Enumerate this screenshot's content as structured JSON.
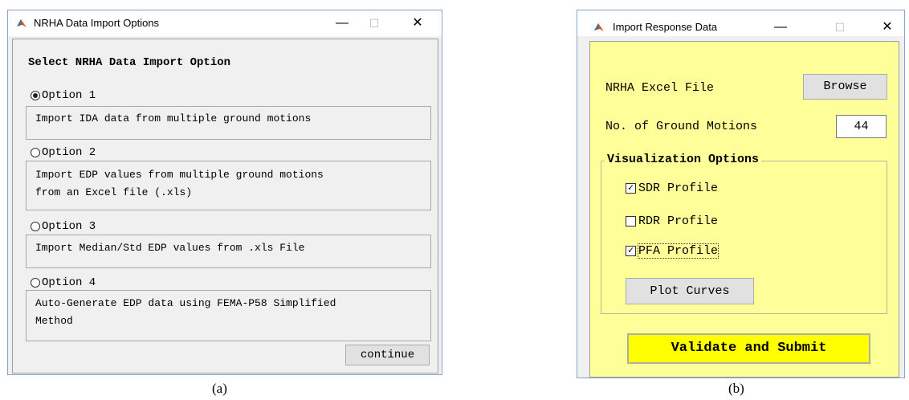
{
  "window_a": {
    "title": "NRHA Data Import Options",
    "minimize_glyph": "—",
    "maximize_glyph": "☐",
    "close_glyph": "✕",
    "header": "Select NRHA Data Import Option",
    "options": [
      {
        "label": "Option 1",
        "selected": true,
        "lines": [
          "Import IDA data from multiple ground motions"
        ]
      },
      {
        "label": "Option 2",
        "selected": false,
        "lines": [
          "Import EDP values from multiple ground motions",
          "from an Excel file (.xls)"
        ]
      },
      {
        "label": "Option 3",
        "selected": false,
        "lines": [
          "Import Median/Std EDP values from .xls File"
        ]
      },
      {
        "label": "Option 4",
        "selected": false,
        "lines": [
          "Auto-Generate EDP data using FEMA-P58 Simplified",
          "Method"
        ]
      }
    ],
    "continue_label": "continue",
    "caption": "(a)"
  },
  "window_b": {
    "title": "Import Response Data",
    "minimize_glyph": "—",
    "maximize_glyph": "☐",
    "close_glyph": "✕",
    "excel_label": "NRHA Excel File",
    "browse_label": "Browse",
    "ground_motions_label": "No. of Ground Motions",
    "ground_motions_value": "44",
    "group_title": "Visualization Options",
    "checkboxes": [
      {
        "label": "SDR Profile",
        "checked": true
      },
      {
        "label": "RDR Profile",
        "checked": false
      },
      {
        "label": "PFA Profile",
        "checked": true
      }
    ],
    "plot_label": "Plot Curves",
    "submit_label": "Validate and Submit",
    "caption": "(b)"
  },
  "colors": {
    "panel_yellow": "#ffff99",
    "submit_yellow": "#ffff00",
    "button_gray": "#e1e1e1"
  }
}
